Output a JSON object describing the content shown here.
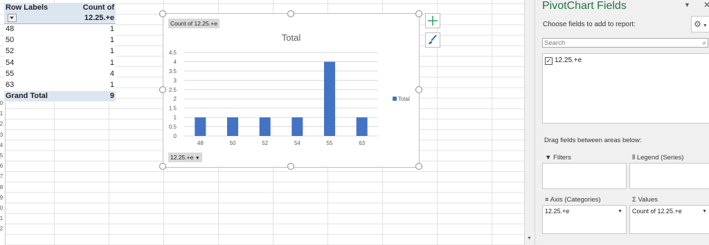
{
  "pivot_table": {
    "headers": {
      "row_labels": "Row Labels",
      "count": "Count of 12.25.+e"
    },
    "rows": [
      {
        "label": "48",
        "value": "1"
      },
      {
        "label": "50",
        "value": "1"
      },
      {
        "label": "52",
        "value": "1"
      },
      {
        "label": "54",
        "value": "1"
      },
      {
        "label": "55",
        "value": "4"
      },
      {
        "label": "63",
        "value": "1"
      }
    ],
    "total": {
      "label": "Grand Total",
      "value": "9"
    }
  },
  "row_headers": [
    "0",
    "1",
    "2",
    "3",
    "4",
    "5",
    "6",
    "7",
    "8",
    "9",
    "0",
    "1",
    "2"
  ],
  "chart": {
    "value_field_button": "Count of 12.25.+e",
    "axis_field_button": "12.25.+e",
    "legend_entry": "Total",
    "bar_color": "#4472c4"
  },
  "chart_data": {
    "type": "bar",
    "title": "Total",
    "categories": [
      "48",
      "50",
      "52",
      "54",
      "55",
      "63"
    ],
    "series": [
      {
        "name": "Total",
        "values": [
          1,
          1,
          1,
          1,
          4,
          1
        ]
      }
    ],
    "ylim": [
      0,
      4.5
    ],
    "yticks": [
      "0",
      "0.5",
      "1",
      "1.5",
      "2",
      "2.5",
      "3",
      "3.5",
      "4",
      "4.5"
    ],
    "grid": true,
    "legend": "right"
  },
  "field_pane": {
    "title": "PivotChart Fields",
    "subtitle": "Choose fields to add to report:",
    "search_placeholder": "Search",
    "fields": [
      {
        "label": "12.25.+e",
        "checked": true
      }
    ],
    "drag_label": "Drag fields between areas below:",
    "areas": {
      "filters": "Filters",
      "legend": "Legend (Series)",
      "axis": "Axis (Categories)",
      "values": "Values",
      "axis_item": "12.25.+e",
      "values_item": "Count of 12.25.+e"
    },
    "accent": "#217346"
  }
}
